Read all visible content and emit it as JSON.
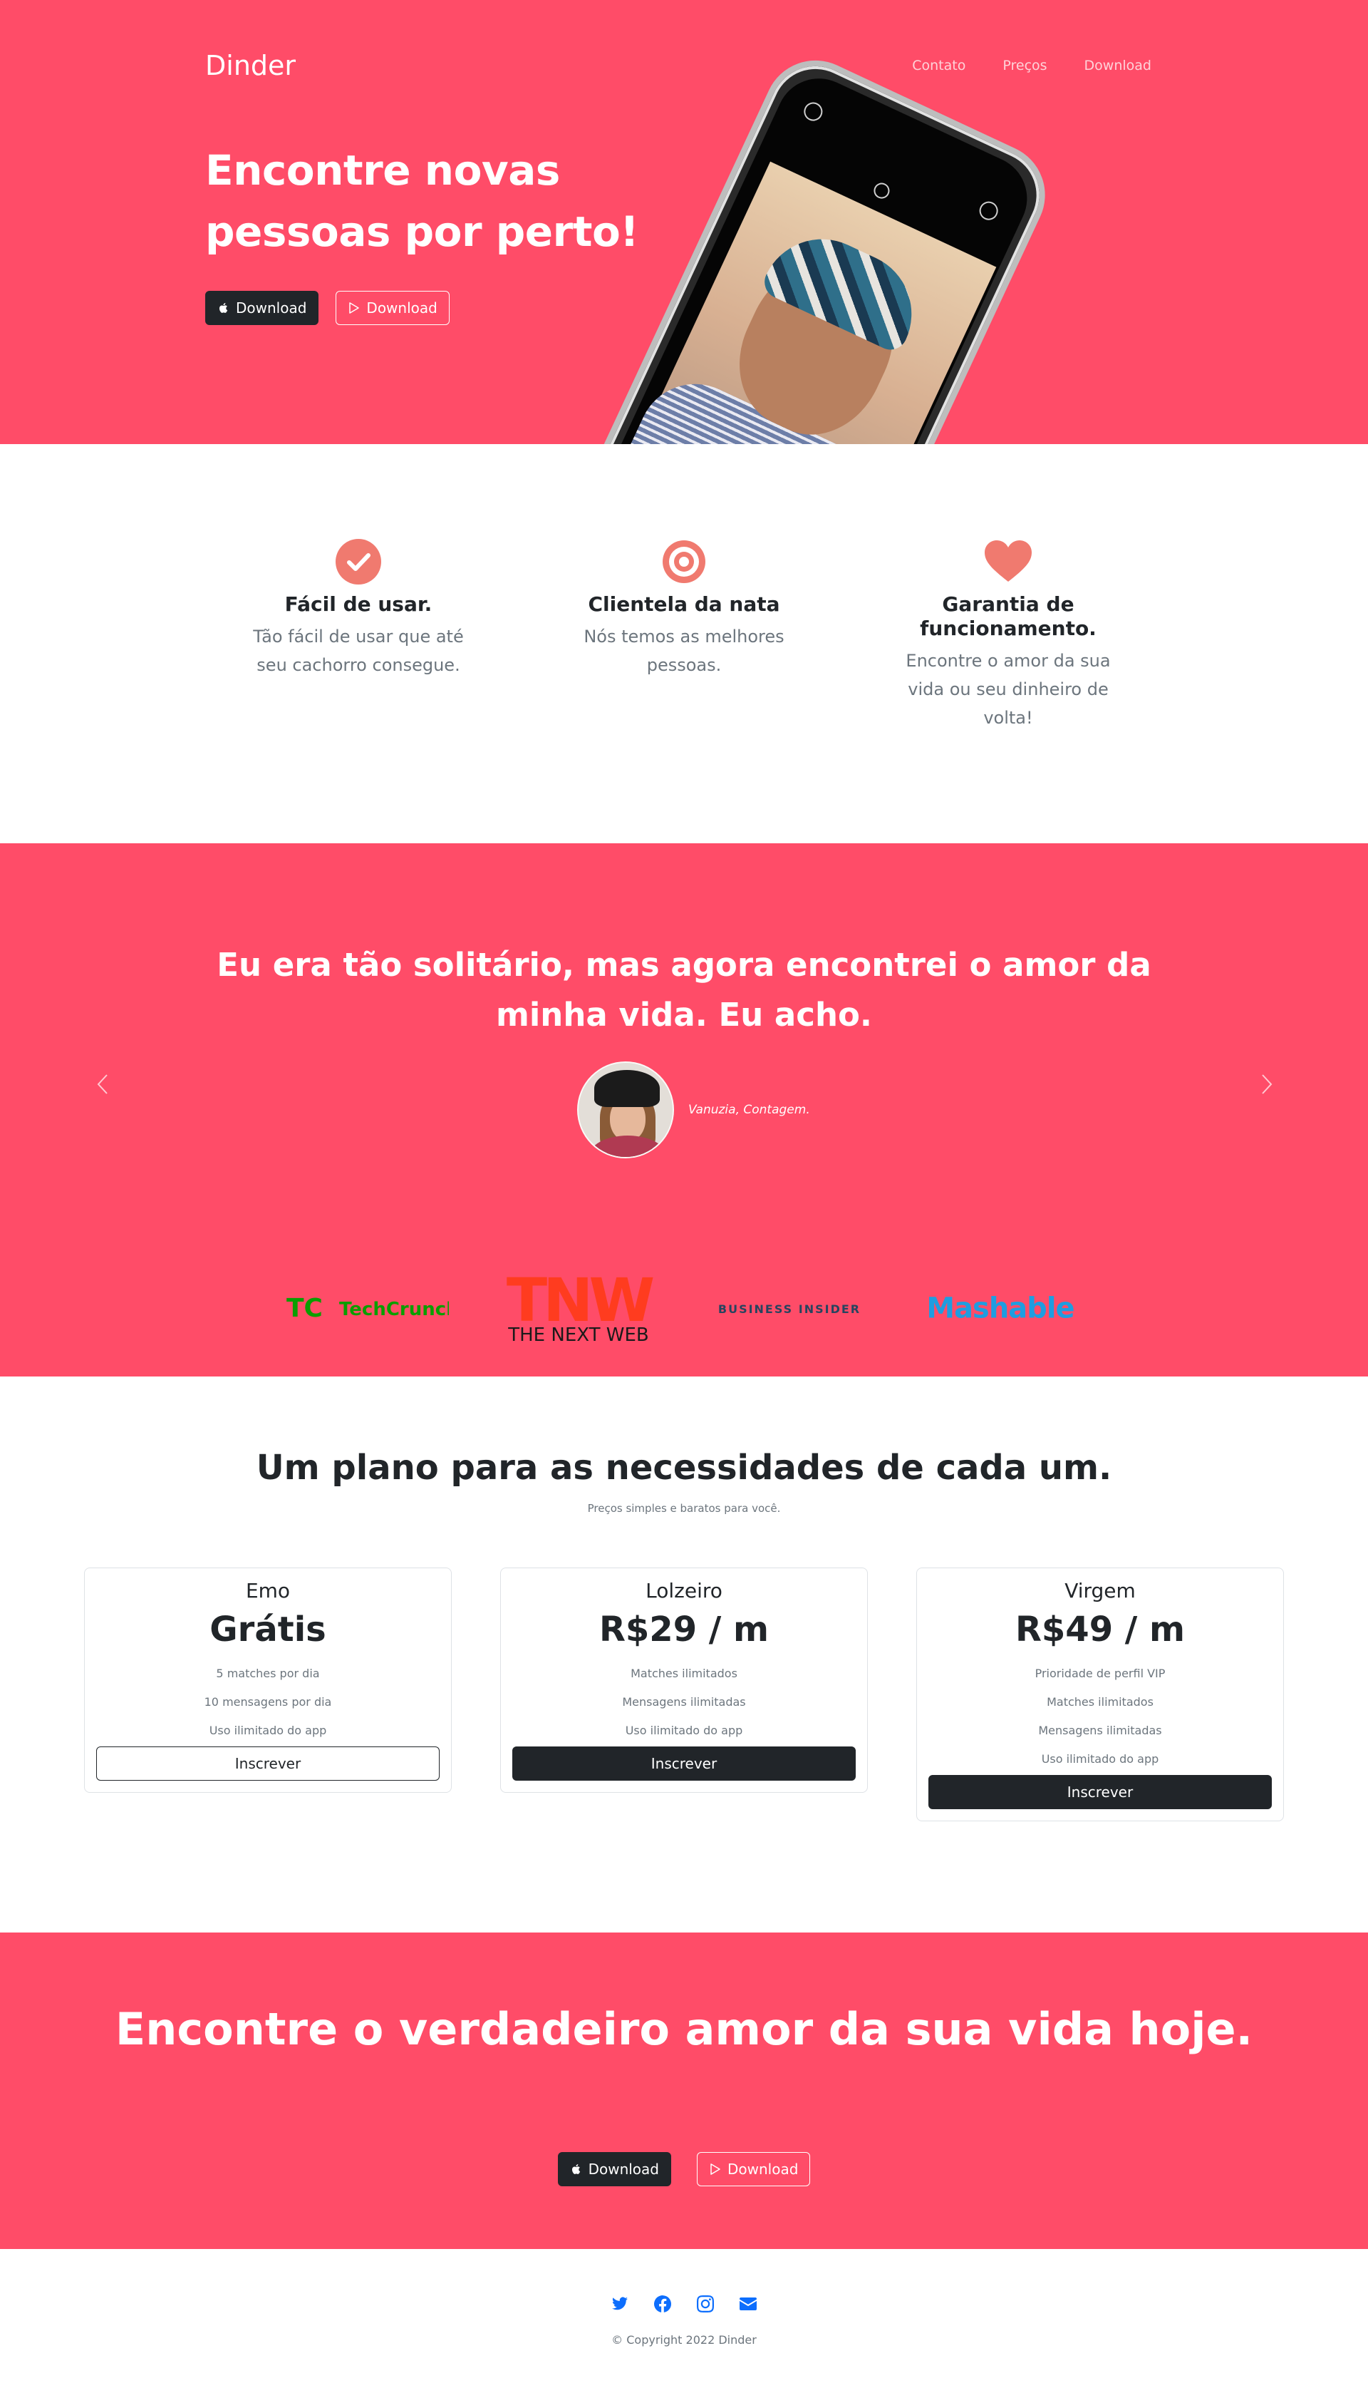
{
  "colors": {
    "brand": "#ff4c68",
    "dark": "#212529",
    "accent_icon": "#f07a6f",
    "social": "#0d6efd"
  },
  "nav": {
    "brand": "Dinder",
    "links": [
      "Contato",
      "Preços",
      "Download"
    ]
  },
  "hero": {
    "title": "Encontre novas pessoas por perto!",
    "ios_button": "Download",
    "android_button": "Download",
    "ios_icon": "apple-icon",
    "android_icon": "play-store-icon"
  },
  "features": [
    {
      "icon": "check-circle-icon",
      "title": "Fácil de usar.",
      "text": "Tão fácil de usar que até seu cachorro consegue."
    },
    {
      "icon": "target-icon",
      "title": "Clientela da nata",
      "text": "Nós temos as melhores pessoas."
    },
    {
      "icon": "heart-icon",
      "title": "Garantia de funcionamento.",
      "text": "Encontre o amor da sua vida ou seu dinheiro de volta!"
    }
  ],
  "testimonial": {
    "quote": "Eu era tão solitário, mas agora encontrei o amor da minha vida. Eu acho.",
    "author": "Vanuzia, Contagem."
  },
  "press": [
    "TechCrunch",
    "THE NEXT WEB",
    "BUSINESS INSIDER",
    "Mashable"
  ],
  "press_marks": {
    "tc": "TC",
    "tnw": "TNW"
  },
  "pricing": {
    "title": "Um plano para as necessidades de cada um.",
    "subtitle": "Preços simples e baratos para você.",
    "plans": [
      {
        "name": "Emo",
        "price": "Grátis",
        "features": [
          "5 matches por dia",
          "10 mensagens por dia",
          "Uso ilimitado do app"
        ],
        "button": "Inscrever"
      },
      {
        "name": "Lolzeiro",
        "price": "R$29 / m",
        "features": [
          "Matches ilimitados",
          "Mensagens ilimitadas",
          "Uso ilimitado do app"
        ],
        "button": "Inscrever"
      },
      {
        "name": "Virgem",
        "price": "R$49 / m",
        "features": [
          "Prioridade de perfil VIP",
          "Matches ilimitados",
          "Mensagens ilimitadas",
          "Uso ilimitado do app"
        ],
        "button": "Inscrever"
      }
    ]
  },
  "cta": {
    "title": "Encontre o verdadeiro amor da sua vida hoje.",
    "ios_button": "Download",
    "android_button": "Download"
  },
  "footer": {
    "socials": [
      "twitter-icon",
      "facebook-icon",
      "instagram-icon",
      "envelope-icon"
    ],
    "copyright": "© Copyright 2022 Dinder"
  }
}
